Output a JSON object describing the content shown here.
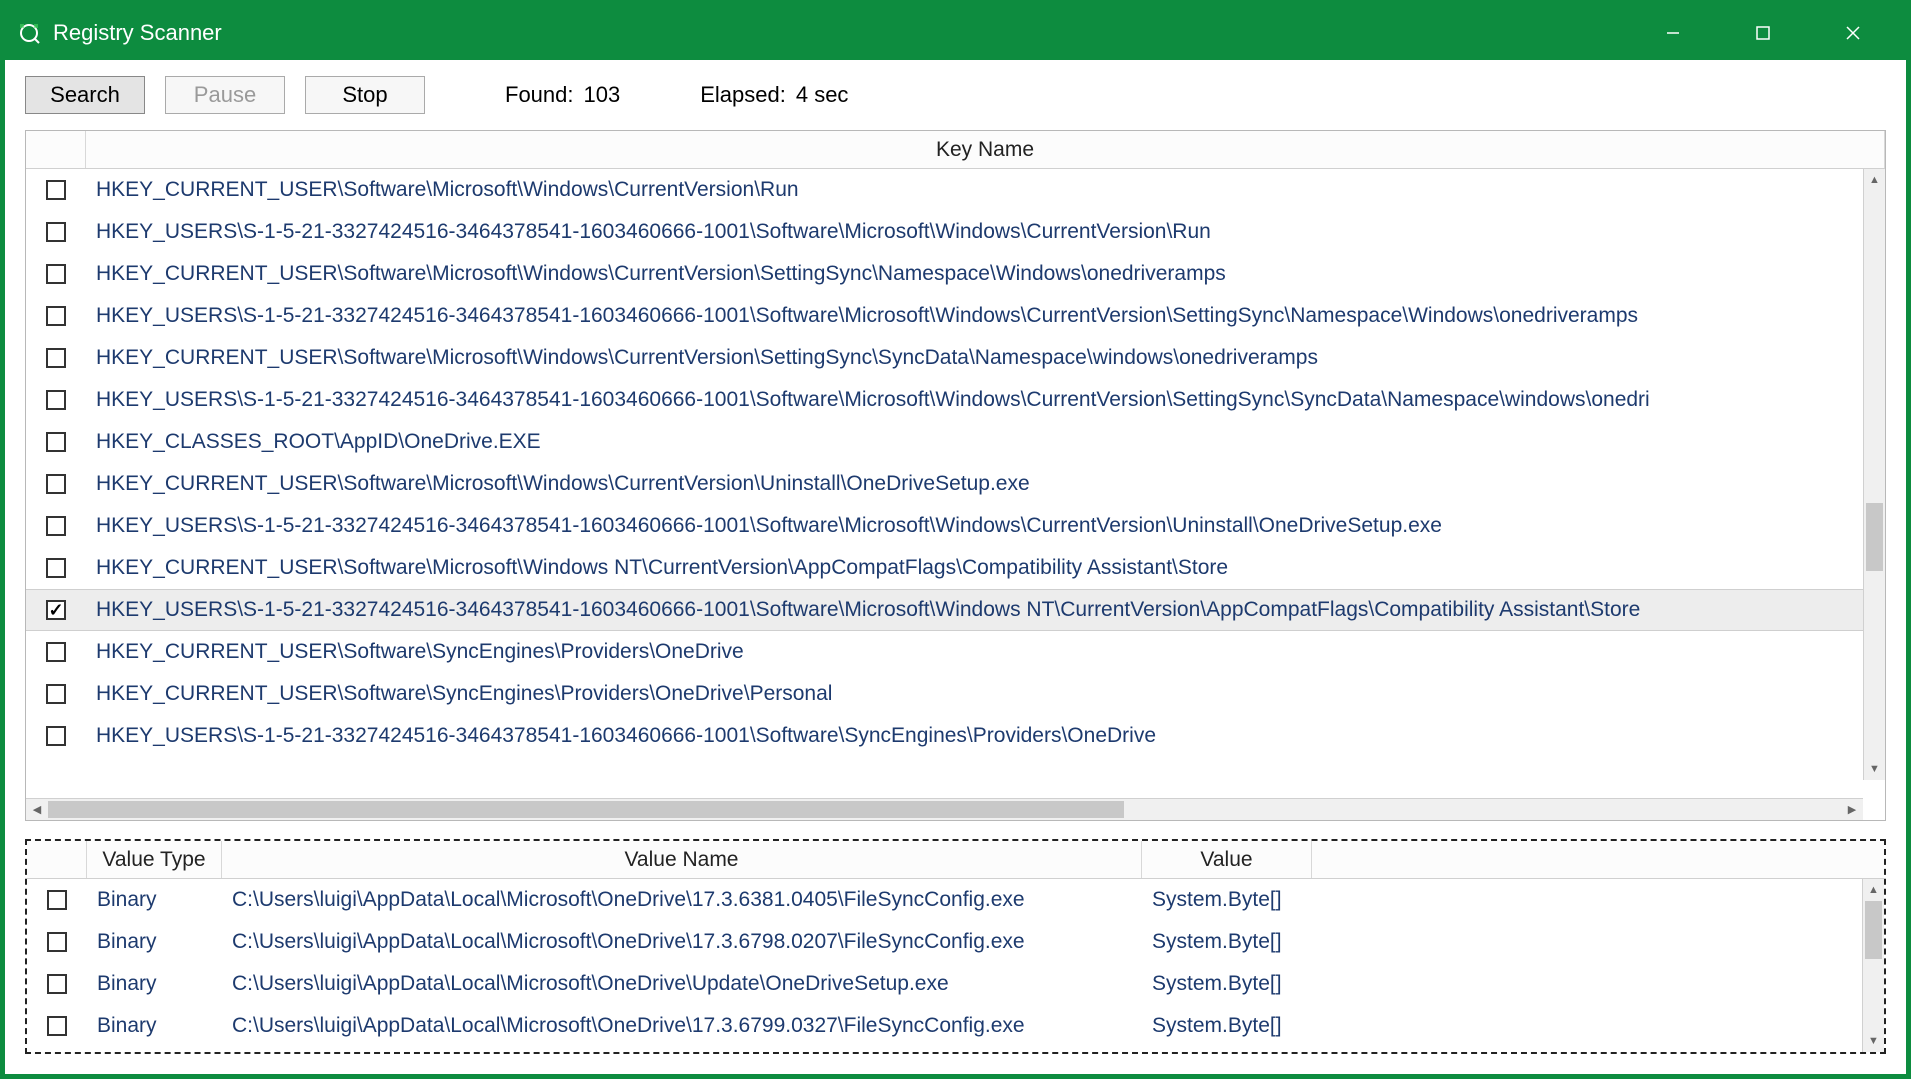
{
  "app": {
    "title": "Registry Scanner"
  },
  "toolbar": {
    "search_label": "Search",
    "pause_label": "Pause",
    "stop_label": "Stop",
    "found_label": "Found:",
    "found_value": "103",
    "elapsed_label": "Elapsed:",
    "elapsed_value": "4 sec"
  },
  "keys_header": {
    "key_name_label": "Key Name"
  },
  "keys": [
    {
      "checked": false,
      "path": "HKEY_CURRENT_USER\\Software\\Microsoft\\Windows\\CurrentVersion\\Run"
    },
    {
      "checked": false,
      "path": "HKEY_USERS\\S-1-5-21-3327424516-3464378541-1603460666-1001\\Software\\Microsoft\\Windows\\CurrentVersion\\Run"
    },
    {
      "checked": false,
      "path": "HKEY_CURRENT_USER\\Software\\Microsoft\\Windows\\CurrentVersion\\SettingSync\\Namespace\\Windows\\onedriveramps"
    },
    {
      "checked": false,
      "path": "HKEY_USERS\\S-1-5-21-3327424516-3464378541-1603460666-1001\\Software\\Microsoft\\Windows\\CurrentVersion\\SettingSync\\Namespace\\Windows\\onedriveramps"
    },
    {
      "checked": false,
      "path": "HKEY_CURRENT_USER\\Software\\Microsoft\\Windows\\CurrentVersion\\SettingSync\\SyncData\\Namespace\\windows\\onedriveramps"
    },
    {
      "checked": false,
      "path": "HKEY_USERS\\S-1-5-21-3327424516-3464378541-1603460666-1001\\Software\\Microsoft\\Windows\\CurrentVersion\\SettingSync\\SyncData\\Namespace\\windows\\onedri"
    },
    {
      "checked": false,
      "path": "HKEY_CLASSES_ROOT\\AppID\\OneDrive.EXE"
    },
    {
      "checked": false,
      "path": "HKEY_CURRENT_USER\\Software\\Microsoft\\Windows\\CurrentVersion\\Uninstall\\OneDriveSetup.exe"
    },
    {
      "checked": false,
      "path": "HKEY_USERS\\S-1-5-21-3327424516-3464378541-1603460666-1001\\Software\\Microsoft\\Windows\\CurrentVersion\\Uninstall\\OneDriveSetup.exe"
    },
    {
      "checked": false,
      "path": "HKEY_CURRENT_USER\\Software\\Microsoft\\Windows NT\\CurrentVersion\\AppCompatFlags\\Compatibility Assistant\\Store"
    },
    {
      "checked": true,
      "path": "HKEY_USERS\\S-1-5-21-3327424516-3464378541-1603460666-1001\\Software\\Microsoft\\Windows NT\\CurrentVersion\\AppCompatFlags\\Compatibility Assistant\\Store",
      "selected": true
    },
    {
      "checked": false,
      "path": "HKEY_CURRENT_USER\\Software\\SyncEngines\\Providers\\OneDrive"
    },
    {
      "checked": false,
      "path": "HKEY_CURRENT_USER\\Software\\SyncEngines\\Providers\\OneDrive\\Personal"
    },
    {
      "checked": false,
      "path": "HKEY_USERS\\S-1-5-21-3327424516-3464378541-1603460666-1001\\Software\\SyncEngines\\Providers\\OneDrive"
    }
  ],
  "values_header": {
    "type_label": "Value Type",
    "name_label": "Value Name",
    "value_label": "Value"
  },
  "values": [
    {
      "checked": false,
      "type": "Binary",
      "name": "C:\\Users\\luigi\\AppData\\Local\\Microsoft\\OneDrive\\17.3.6381.0405\\FileSyncConfig.exe",
      "value": "System.Byte[]"
    },
    {
      "checked": false,
      "type": "Binary",
      "name": "C:\\Users\\luigi\\AppData\\Local\\Microsoft\\OneDrive\\17.3.6798.0207\\FileSyncConfig.exe",
      "value": "System.Byte[]"
    },
    {
      "checked": false,
      "type": "Binary",
      "name": "C:\\Users\\luigi\\AppData\\Local\\Microsoft\\OneDrive\\Update\\OneDriveSetup.exe",
      "value": "System.Byte[]"
    },
    {
      "checked": false,
      "type": "Binary",
      "name": "C:\\Users\\luigi\\AppData\\Local\\Microsoft\\OneDrive\\17.3.6799.0327\\FileSyncConfig.exe",
      "value": "System.Byte[]"
    }
  ]
}
